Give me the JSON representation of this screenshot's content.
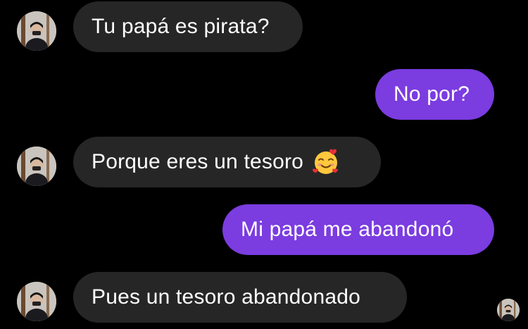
{
  "conversation": {
    "messages": [
      {
        "direction": "incoming",
        "text": "Tu papá es pirata?"
      },
      {
        "direction": "outgoing",
        "text": "No por?"
      },
      {
        "direction": "incoming",
        "text": "Porque eres un tesoro",
        "emoji": "smiling-face-with-hearts"
      },
      {
        "direction": "outgoing",
        "text": "Mi papá me abandonó"
      },
      {
        "direction": "incoming",
        "text": "Pues un tesoro abandonado"
      }
    ]
  },
  "icons": {
    "sender_avatar": "contact-avatar-icon",
    "seen_indicator": "seen-avatar-icon",
    "emoji": "smiling-face-with-hearts-icon"
  },
  "colors": {
    "background": "#000000",
    "incoming_bubble": "#262626",
    "outgoing_bubble": "#7b3ce0",
    "text": "#ffffff"
  }
}
